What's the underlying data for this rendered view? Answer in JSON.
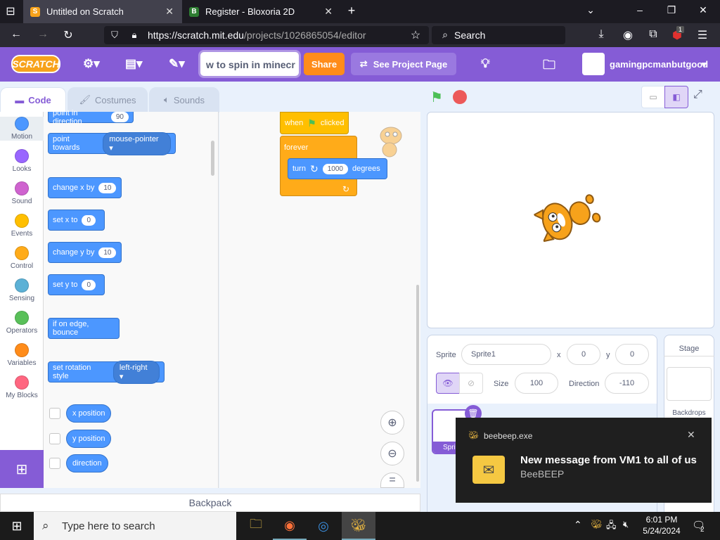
{
  "browser": {
    "tabs": [
      {
        "title": "Untitled on Scratch",
        "icon": "scratch-favicon"
      },
      {
        "title": "Register - Bloxoria 2D",
        "icon": "bloxoria-favicon"
      }
    ],
    "url_host": "https://scratch.mit.edu",
    "url_path": "/projects/1026865054/editor",
    "search_placeholder": "Search",
    "extension_badge": "1"
  },
  "menubar": {
    "logo": "SCRATCH",
    "project_title": "w to spin in minecr",
    "share": "Share",
    "see_project_page": "See Project Page",
    "username": "gamingpcmanbutgood"
  },
  "editor_tabs": [
    "Code",
    "Costumes",
    "Sounds"
  ],
  "categories": [
    {
      "label": "Motion",
      "color": "#4c97ff"
    },
    {
      "label": "Looks",
      "color": "#9966ff"
    },
    {
      "label": "Sound",
      "color": "#cf63cf"
    },
    {
      "label": "Events",
      "color": "#ffbf00"
    },
    {
      "label": "Control",
      "color": "#ffab19"
    },
    {
      "label": "Sensing",
      "color": "#5cb1d6"
    },
    {
      "label": "Operators",
      "color": "#59c059"
    },
    {
      "label": "Variables",
      "color": "#ff8c1a"
    },
    {
      "label": "My Blocks",
      "color": "#ff6680"
    }
  ],
  "palette": {
    "point_in_direction": "point in direction",
    "point_in_direction_val": "90",
    "point_towards": "point towards",
    "point_towards_val": "mouse-pointer",
    "change_x": "change x by",
    "change_x_val": "10",
    "set_x": "set x to",
    "set_x_val": "0",
    "change_y": "change y by",
    "change_y_val": "10",
    "set_y": "set y to",
    "set_y_val": "0",
    "bounce": "if on edge, bounce",
    "rotation_style": "set rotation style",
    "rotation_style_val": "left-right",
    "reporters": [
      "x position",
      "y position",
      "direction"
    ]
  },
  "script": {
    "when": "when",
    "clicked": "clicked",
    "forever": "forever",
    "turn": "turn",
    "turn_val": "1000",
    "degrees": "degrees"
  },
  "sprite_info": {
    "sprite_label": "Sprite",
    "sprite_name": "Sprite1",
    "x_label": "x",
    "x": "0",
    "y_label": "y",
    "y": "0",
    "size_label": "Size",
    "size": "100",
    "direction_label": "Direction",
    "direction": "-110",
    "sprite_thumb_label": "Sprite1"
  },
  "stage_panel": {
    "title": "Stage",
    "backdrops": "Backdrops"
  },
  "backpack": "Backpack",
  "notification": {
    "app": "beebeep.exe",
    "title": "New message from VM1 to all of us",
    "source": "BeeBEEP"
  },
  "taskbar": {
    "search_placeholder": "Type here to search",
    "time": "6:01 PM",
    "date": "5/24/2024",
    "notif_count": "2"
  }
}
